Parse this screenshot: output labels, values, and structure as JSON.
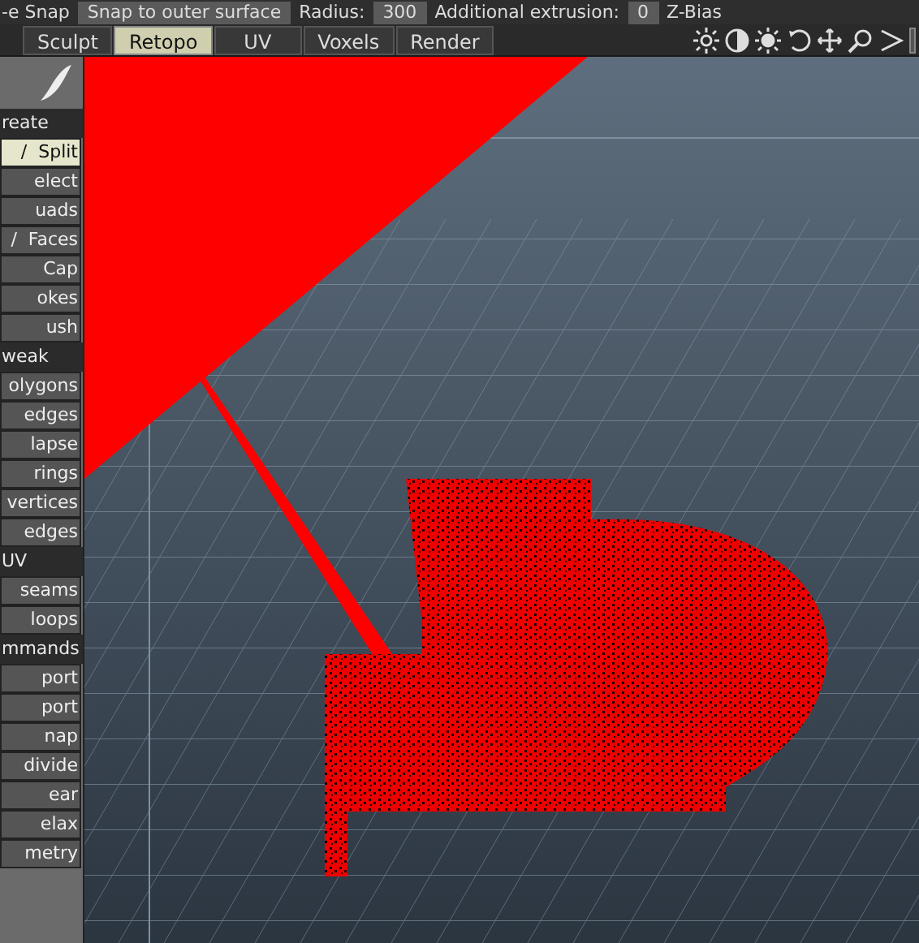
{
  "toolbar": {
    "items": [
      {
        "kind": "label",
        "text": "-e Snap"
      },
      {
        "kind": "field",
        "text": "Snap to outer surface"
      },
      {
        "kind": "label",
        "text": "Radius:"
      },
      {
        "kind": "field",
        "text": "300"
      },
      {
        "kind": "label",
        "text": "Additional extrusion:"
      },
      {
        "kind": "field",
        "text": "0"
      },
      {
        "kind": "label",
        "text": "Z-Bias"
      }
    ]
  },
  "tabs": [
    {
      "label": "Sculpt",
      "selected": false
    },
    {
      "label": "Retopo",
      "selected": true
    },
    {
      "label": "UV",
      "selected": false
    },
    {
      "label": "Voxels",
      "selected": false
    },
    {
      "label": "Render",
      "selected": false
    }
  ],
  "sidebar": {
    "items": [
      {
        "kind": "header",
        "label": "reate"
      },
      {
        "kind": "tool",
        "label": "/  Split",
        "selected": true
      },
      {
        "kind": "tool",
        "label": "elect",
        "selected": false
      },
      {
        "kind": "tool",
        "label": "uads",
        "selected": false
      },
      {
        "kind": "tool",
        "label": "/  Faces",
        "selected": false
      },
      {
        "kind": "tool",
        "label": "Cap",
        "selected": false
      },
      {
        "kind": "tool",
        "label": "okes",
        "selected": false
      },
      {
        "kind": "tool",
        "label": "ush",
        "selected": false
      },
      {
        "kind": "header",
        "label": "weak"
      },
      {
        "kind": "tool",
        "label": "olygons",
        "selected": false
      },
      {
        "kind": "tool",
        "label": "edges",
        "selected": false
      },
      {
        "kind": "tool",
        "label": "lapse",
        "selected": false
      },
      {
        "kind": "tool",
        "label": "rings",
        "selected": false
      },
      {
        "kind": "tool",
        "label": "vertices",
        "selected": false
      },
      {
        "kind": "tool",
        "label": "edges",
        "selected": false
      },
      {
        "kind": "header",
        "label": "UV"
      },
      {
        "kind": "tool",
        "label": "seams",
        "selected": false
      },
      {
        "kind": "tool",
        "label": "loops",
        "selected": false
      },
      {
        "kind": "header",
        "label": "mmands"
      },
      {
        "kind": "tool",
        "label": "port",
        "selected": false
      },
      {
        "kind": "tool",
        "label": "port",
        "selected": false
      },
      {
        "kind": "tool",
        "label": "nap",
        "selected": false
      },
      {
        "kind": "tool",
        "label": "divide",
        "selected": false
      },
      {
        "kind": "tool",
        "label": "ear",
        "selected": false
      },
      {
        "kind": "tool",
        "label": "elax",
        "selected": false
      },
      {
        "kind": "tool",
        "label": "metry",
        "selected": false
      }
    ]
  }
}
